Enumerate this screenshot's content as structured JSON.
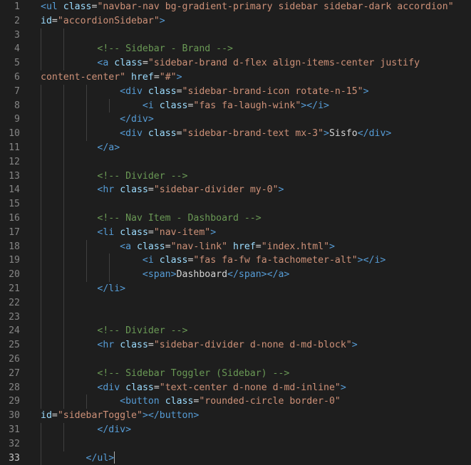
{
  "editor": {
    "language": "html",
    "colors": {
      "background": "#1e1e1e",
      "line_number": "#858585",
      "tag": "#569cd6",
      "attribute": "#9cdcfe",
      "string": "#ce9178",
      "comment": "#6a9955",
      "text": "#d4d4d4"
    },
    "active_line": 33,
    "lines": [
      {
        "n": "1",
        "guides": 0,
        "tokens": [
          [
            "tag",
            "<ul"
          ],
          [
            "txt",
            " "
          ],
          [
            "attr",
            "class"
          ],
          [
            "txt",
            "="
          ],
          [
            "str",
            "\"navbar-nav bg-gradient-primary sidebar sidebar-dark accordion\""
          ]
        ]
      },
      {
        "n": "2",
        "guides": 0,
        "tokens": [
          [
            "attr",
            "id"
          ],
          [
            "txt",
            "="
          ],
          [
            "str",
            "\"accordionSidebar\""
          ],
          [
            "tag",
            ">"
          ]
        ]
      },
      {
        "n": "3",
        "guides": 2,
        "tokens": []
      },
      {
        "n": "4",
        "guides": 2,
        "indent": "          ",
        "tokens": [
          [
            "cmt",
            "<!-- Sidebar - Brand -->"
          ]
        ]
      },
      {
        "n": "5",
        "guides": 2,
        "indent": "          ",
        "tokens": [
          [
            "tag",
            "<a"
          ],
          [
            "txt",
            " "
          ],
          [
            "attr",
            "class"
          ],
          [
            "txt",
            "="
          ],
          [
            "str",
            "\"sidebar-brand d-flex align-items-center justify"
          ]
        ]
      },
      {
        "n": "6",
        "guides": 0,
        "tokens": [
          [
            "str",
            "content-center\""
          ],
          [
            "txt",
            " "
          ],
          [
            "attr",
            "href"
          ],
          [
            "txt",
            "="
          ],
          [
            "str",
            "\"#\""
          ],
          [
            "tag",
            ">"
          ]
        ]
      },
      {
        "n": "7",
        "guides": 3,
        "indent": "              ",
        "tokens": [
          [
            "tag",
            "<div"
          ],
          [
            "txt",
            " "
          ],
          [
            "attr",
            "class"
          ],
          [
            "txt",
            "="
          ],
          [
            "str",
            "\"sidebar-brand-icon rotate-n-15\""
          ],
          [
            "tag",
            ">"
          ]
        ]
      },
      {
        "n": "8",
        "guides": 4,
        "indent": "                  ",
        "tokens": [
          [
            "tag",
            "<i"
          ],
          [
            "txt",
            " "
          ],
          [
            "attr",
            "class"
          ],
          [
            "txt",
            "="
          ],
          [
            "str",
            "\"fas fa-laugh-wink\""
          ],
          [
            "tag",
            "></i>"
          ]
        ]
      },
      {
        "n": "9",
        "guides": 3,
        "indent": "              ",
        "tokens": [
          [
            "tag",
            "</div>"
          ]
        ]
      },
      {
        "n": "10",
        "guides": 3,
        "indent": "              ",
        "tokens": [
          [
            "tag",
            "<div"
          ],
          [
            "txt",
            " "
          ],
          [
            "attr",
            "class"
          ],
          [
            "txt",
            "="
          ],
          [
            "str",
            "\"sidebar-brand-text mx-3\""
          ],
          [
            "tag",
            ">"
          ],
          [
            "txt",
            "Sisfo"
          ],
          [
            "tag",
            "</div>"
          ]
        ]
      },
      {
        "n": "11",
        "guides": 2,
        "indent": "          ",
        "tokens": [
          [
            "tag",
            "</a>"
          ]
        ]
      },
      {
        "n": "12",
        "guides": 2,
        "tokens": []
      },
      {
        "n": "13",
        "guides": 2,
        "indent": "          ",
        "tokens": [
          [
            "cmt",
            "<!-- Divider -->"
          ]
        ]
      },
      {
        "n": "14",
        "guides": 2,
        "indent": "          ",
        "tokens": [
          [
            "tag",
            "<hr"
          ],
          [
            "txt",
            " "
          ],
          [
            "attr",
            "class"
          ],
          [
            "txt",
            "="
          ],
          [
            "str",
            "\"sidebar-divider my-0\""
          ],
          [
            "tag",
            ">"
          ]
        ]
      },
      {
        "n": "15",
        "guides": 2,
        "tokens": []
      },
      {
        "n": "16",
        "guides": 2,
        "indent": "          ",
        "tokens": [
          [
            "cmt",
            "<!-- Nav Item - Dashboard -->"
          ]
        ]
      },
      {
        "n": "17",
        "guides": 2,
        "indent": "          ",
        "tokens": [
          [
            "tag",
            "<li"
          ],
          [
            "txt",
            " "
          ],
          [
            "attr",
            "class"
          ],
          [
            "txt",
            "="
          ],
          [
            "str",
            "\"nav-item\""
          ],
          [
            "tag",
            ">"
          ]
        ]
      },
      {
        "n": "18",
        "guides": 3,
        "indent": "              ",
        "tokens": [
          [
            "tag",
            "<a"
          ],
          [
            "txt",
            " "
          ],
          [
            "attr",
            "class"
          ],
          [
            "txt",
            "="
          ],
          [
            "str",
            "\"nav-link\""
          ],
          [
            "txt",
            " "
          ],
          [
            "attr",
            "href"
          ],
          [
            "txt",
            "="
          ],
          [
            "str",
            "\"index.html\""
          ],
          [
            "tag",
            ">"
          ]
        ]
      },
      {
        "n": "19",
        "guides": 4,
        "indent": "                  ",
        "tokens": [
          [
            "tag",
            "<i"
          ],
          [
            "txt",
            " "
          ],
          [
            "attr",
            "class"
          ],
          [
            "txt",
            "="
          ],
          [
            "str",
            "\"fas fa-fw fa-tachometer-alt\""
          ],
          [
            "tag",
            "></i>"
          ]
        ]
      },
      {
        "n": "20",
        "guides": 4,
        "indent": "                  ",
        "tokens": [
          [
            "tag",
            "<span>"
          ],
          [
            "txt",
            "Dashboard"
          ],
          [
            "tag",
            "</span></a>"
          ]
        ]
      },
      {
        "n": "21",
        "guides": 2,
        "indent": "          ",
        "tokens": [
          [
            "tag",
            "</li>"
          ]
        ]
      },
      {
        "n": "22",
        "guides": 2,
        "tokens": []
      },
      {
        "n": "23",
        "guides": 2,
        "tokens": []
      },
      {
        "n": "24",
        "guides": 2,
        "indent": "          ",
        "tokens": [
          [
            "cmt",
            "<!-- Divider -->"
          ]
        ]
      },
      {
        "n": "25",
        "guides": 2,
        "indent": "          ",
        "tokens": [
          [
            "tag",
            "<hr"
          ],
          [
            "txt",
            " "
          ],
          [
            "attr",
            "class"
          ],
          [
            "txt",
            "="
          ],
          [
            "str",
            "\"sidebar-divider d-none d-md-block\""
          ],
          [
            "tag",
            ">"
          ]
        ]
      },
      {
        "n": "26",
        "guides": 2,
        "tokens": []
      },
      {
        "n": "27",
        "guides": 2,
        "indent": "          ",
        "tokens": [
          [
            "cmt",
            "<!-- Sidebar Toggler (Sidebar) -->"
          ]
        ]
      },
      {
        "n": "28",
        "guides": 2,
        "indent": "          ",
        "tokens": [
          [
            "tag",
            "<div"
          ],
          [
            "txt",
            " "
          ],
          [
            "attr",
            "class"
          ],
          [
            "txt",
            "="
          ],
          [
            "str",
            "\"text-center d-none d-md-inline\""
          ],
          [
            "tag",
            ">"
          ]
        ]
      },
      {
        "n": "29",
        "guides": 3,
        "indent": "              ",
        "tokens": [
          [
            "tag",
            "<button"
          ],
          [
            "txt",
            " "
          ],
          [
            "attr",
            "class"
          ],
          [
            "txt",
            "="
          ],
          [
            "str",
            "\"rounded-circle border-0\""
          ]
        ]
      },
      {
        "n": "30",
        "guides": 0,
        "tokens": [
          [
            "attr",
            "id"
          ],
          [
            "txt",
            "="
          ],
          [
            "str",
            "\"sidebarToggle\""
          ],
          [
            "tag",
            "></button>"
          ]
        ]
      },
      {
        "n": "31",
        "guides": 2,
        "indent": "          ",
        "tokens": [
          [
            "tag",
            "</div>"
          ]
        ]
      },
      {
        "n": "32",
        "guides": 2,
        "tokens": []
      },
      {
        "n": "33",
        "guides": 1,
        "indent": "        ",
        "tokens": [
          [
            "tag",
            "</ul>"
          ]
        ],
        "cursor": true
      }
    ]
  }
}
